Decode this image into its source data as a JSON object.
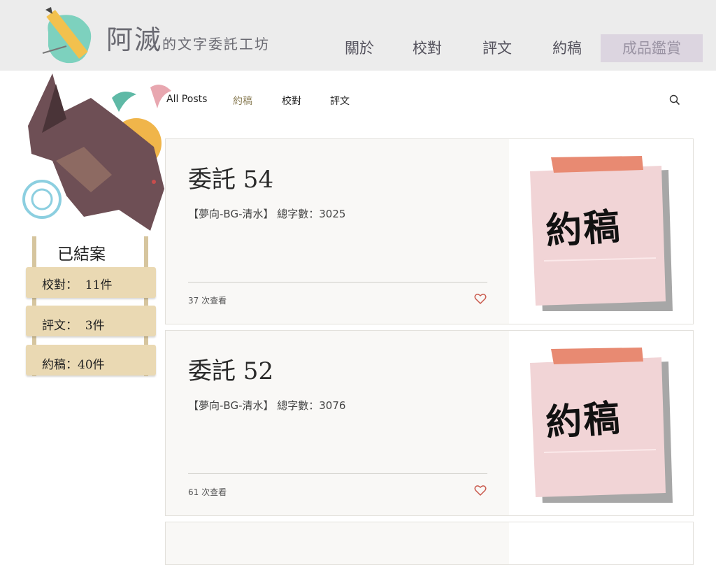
{
  "site": {
    "title_main": "阿滅",
    "title_sub": "的文字委託工坊"
  },
  "nav": [
    {
      "label": "關於"
    },
    {
      "label": "校對"
    },
    {
      "label": "評文"
    },
    {
      "label": "約稿"
    },
    {
      "label": "成品鑑賞",
      "active": true
    }
  ],
  "stats": {
    "title": "已結案",
    "rows": [
      {
        "text": "校對：  11件"
      },
      {
        "text": "評文：  3件"
      },
      {
        "text": "約稿：40件"
      }
    ]
  },
  "categories": [
    {
      "label": "All Posts"
    },
    {
      "label": "約稿",
      "active": true
    },
    {
      "label": "校對"
    },
    {
      "label": "評文"
    }
  ],
  "posts": [
    {
      "title": "委託 54",
      "subtitle": "【夢向-BG-清水】 總字數：3025",
      "views": "37 次查看",
      "image_text": "約稿"
    },
    {
      "title": "委託 52",
      "subtitle": "【夢向-BG-清水】 總字數：3076",
      "views": "61 次查看",
      "image_text": "約稿"
    }
  ],
  "colors": {
    "accent": "#8a7d55",
    "heart": "#c9594c",
    "nav_active_bg": "#dcd5e0"
  },
  "icons": {
    "search": "search-icon",
    "heart": "heart-icon"
  }
}
